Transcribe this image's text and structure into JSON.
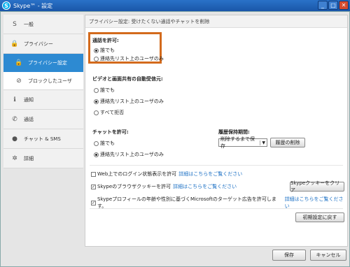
{
  "window": {
    "title": "Skype™ - 設定",
    "app_icon": "S"
  },
  "sidebar": {
    "items": [
      {
        "label": "一般",
        "icon": "skype-logo-icon",
        "glyph": "S"
      },
      {
        "label": "プライバシー",
        "icon": "lock-icon",
        "glyph": "🔒"
      },
      {
        "label": "プライバシー設定",
        "icon": "lock-icon",
        "glyph": "🔒"
      },
      {
        "label": "ブロックしたユーザ",
        "icon": "block-icon",
        "glyph": "⊘"
      },
      {
        "label": "通知",
        "icon": "info-icon",
        "glyph": "ℹ"
      },
      {
        "label": "通話",
        "icon": "phone-icon",
        "glyph": "✆"
      },
      {
        "label": "チャット & SMS",
        "icon": "chat-icon",
        "glyph": "●"
      },
      {
        "label": "詳細",
        "icon": "gear-icon",
        "glyph": "✲"
      }
    ]
  },
  "header": {
    "text": "プライバシー設定: 受けたくない通話やチャットを削除"
  },
  "calls": {
    "title": "通話を許可:",
    "options": [
      "誰でも",
      "連絡先リスト上のユーザのみ"
    ],
    "selected": 0
  },
  "video": {
    "title": "ビデオと画面共有の自動受信元:",
    "options": [
      "誰でも",
      "連絡先リスト上のユーザのみ",
      "すべて拒否"
    ],
    "selected": 1
  },
  "chat": {
    "title": "チャットを許可:",
    "options": [
      "誰でも",
      "連絡先リスト上のユーザのみ"
    ],
    "selected": 1
  },
  "history": {
    "title": "履歴保持期間:",
    "select_value": "削除するまで保存",
    "clear_button": "履歴の削除"
  },
  "checkboxes": [
    {
      "label": "Web上でのログイン状態表示を許可",
      "link": "詳細はこちらをご覧ください",
      "checked": false
    },
    {
      "label": "Skypeのブラウザクッキーを許可",
      "link": "詳細はこちらをご覧ください",
      "checked": true
    },
    {
      "label": "Skypeプロフィールの年齢や性別に基づくMicrosoftのターゲット広告を許可します。",
      "link": "詳細はこちらをご覧ください",
      "checked": true
    }
  ],
  "buttons": {
    "clear_cookies": "Skypeクッキーをクリア",
    "reset": "初期設定に戻す",
    "save": "保存",
    "cancel": "キャンセル"
  },
  "colors": {
    "accent": "#2d8ad2",
    "highlight": "#d36a1c",
    "link": "#1a6fc4"
  }
}
